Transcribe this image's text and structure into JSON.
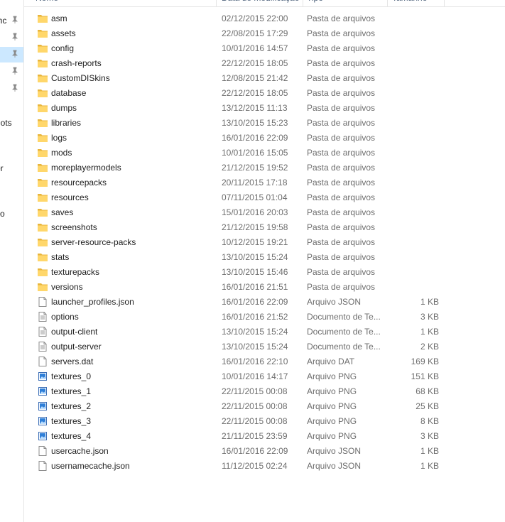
{
  "header": {
    "columns": [
      "Nome",
      "Data de modificação",
      "Tipo",
      "Tamanho"
    ]
  },
  "nav": {
    "items": [
      {
        "label": "lhc",
        "pinned": true,
        "selected": false
      },
      {
        "label": "",
        "pinned": true,
        "selected": false
      },
      {
        "label": "",
        "pinned": true,
        "selected": true
      },
      {
        "label": "",
        "pinned": true,
        "selected": false
      },
      {
        "label": "",
        "pinned": true,
        "selected": false
      },
      {
        "label": "hots",
        "pinned": false,
        "selected": false
      },
      {
        "label": "or",
        "pinned": false,
        "selected": false
      },
      {
        "label": "co",
        "pinned": false,
        "selected": false
      }
    ]
  },
  "files": [
    {
      "name": "asm",
      "date": "02/12/2015 22:00",
      "type": "Pasta de arquivos",
      "size": "",
      "icon": "folder-icon"
    },
    {
      "name": "assets",
      "date": "22/08/2015 17:29",
      "type": "Pasta de arquivos",
      "size": "",
      "icon": "folder-icon"
    },
    {
      "name": "config",
      "date": "10/01/2016 14:57",
      "type": "Pasta de arquivos",
      "size": "",
      "icon": "folder-icon"
    },
    {
      "name": "crash-reports",
      "date": "22/12/2015 18:05",
      "type": "Pasta de arquivos",
      "size": "",
      "icon": "folder-icon"
    },
    {
      "name": "CustomDISkins",
      "date": "12/08/2015 21:42",
      "type": "Pasta de arquivos",
      "size": "",
      "icon": "folder-icon"
    },
    {
      "name": "database",
      "date": "22/12/2015 18:05",
      "type": "Pasta de arquivos",
      "size": "",
      "icon": "folder-icon"
    },
    {
      "name": "dumps",
      "date": "13/12/2015 11:13",
      "type": "Pasta de arquivos",
      "size": "",
      "icon": "folder-icon"
    },
    {
      "name": "libraries",
      "date": "13/10/2015 15:23",
      "type": "Pasta de arquivos",
      "size": "",
      "icon": "folder-icon"
    },
    {
      "name": "logs",
      "date": "16/01/2016 22:09",
      "type": "Pasta de arquivos",
      "size": "",
      "icon": "folder-icon"
    },
    {
      "name": "mods",
      "date": "10/01/2016 15:05",
      "type": "Pasta de arquivos",
      "size": "",
      "icon": "folder-icon"
    },
    {
      "name": "moreplayermodels",
      "date": "21/12/2015 19:52",
      "type": "Pasta de arquivos",
      "size": "",
      "icon": "folder-icon"
    },
    {
      "name": "resourcepacks",
      "date": "20/11/2015 17:18",
      "type": "Pasta de arquivos",
      "size": "",
      "icon": "folder-icon"
    },
    {
      "name": "resources",
      "date": "07/11/2015 01:04",
      "type": "Pasta de arquivos",
      "size": "",
      "icon": "folder-icon"
    },
    {
      "name": "saves",
      "date": "15/01/2016 20:03",
      "type": "Pasta de arquivos",
      "size": "",
      "icon": "folder-icon"
    },
    {
      "name": "screenshots",
      "date": "21/12/2015 19:58",
      "type": "Pasta de arquivos",
      "size": "",
      "icon": "folder-icon"
    },
    {
      "name": "server-resource-packs",
      "date": "10/12/2015 19:21",
      "type": "Pasta de arquivos",
      "size": "",
      "icon": "folder-icon"
    },
    {
      "name": "stats",
      "date": "13/10/2015 15:24",
      "type": "Pasta de arquivos",
      "size": "",
      "icon": "folder-icon"
    },
    {
      "name": "texturepacks",
      "date": "13/10/2015 15:46",
      "type": "Pasta de arquivos",
      "size": "",
      "icon": "folder-icon"
    },
    {
      "name": "versions",
      "date": "16/01/2016 21:51",
      "type": "Pasta de arquivos",
      "size": "",
      "icon": "folder-icon"
    },
    {
      "name": "launcher_profiles.json",
      "date": "16/01/2016 22:09",
      "type": "Arquivo JSON",
      "size": "1 KB",
      "icon": "file-icon"
    },
    {
      "name": "options",
      "date": "16/01/2016 21:52",
      "type": "Documento de Te...",
      "size": "3 KB",
      "icon": "text-file-icon"
    },
    {
      "name": "output-client",
      "date": "13/10/2015 15:24",
      "type": "Documento de Te...",
      "size": "1 KB",
      "icon": "text-file-icon"
    },
    {
      "name": "output-server",
      "date": "13/10/2015 15:24",
      "type": "Documento de Te...",
      "size": "2 KB",
      "icon": "text-file-icon"
    },
    {
      "name": "servers.dat",
      "date": "16/01/2016 22:10",
      "type": "Arquivo DAT",
      "size": "169 KB",
      "icon": "file-icon"
    },
    {
      "name": "textures_0",
      "date": "10/01/2016 14:17",
      "type": "Arquivo PNG",
      "size": "151 KB",
      "icon": "image-file-icon"
    },
    {
      "name": "textures_1",
      "date": "22/11/2015 00:08",
      "type": "Arquivo PNG",
      "size": "68 KB",
      "icon": "image-file-icon"
    },
    {
      "name": "textures_2",
      "date": "22/11/2015 00:08",
      "type": "Arquivo PNG",
      "size": "25 KB",
      "icon": "image-file-icon"
    },
    {
      "name": "textures_3",
      "date": "22/11/2015 00:08",
      "type": "Arquivo PNG",
      "size": "8 KB",
      "icon": "image-file-icon"
    },
    {
      "name": "textures_4",
      "date": "21/11/2015 23:59",
      "type": "Arquivo PNG",
      "size": "3 KB",
      "icon": "image-file-icon"
    },
    {
      "name": "usercache.json",
      "date": "16/01/2016 22:09",
      "type": "Arquivo JSON",
      "size": "1 KB",
      "icon": "file-icon"
    },
    {
      "name": "usernamecache.json",
      "date": "11/12/2015 02:24",
      "type": "Arquivo JSON",
      "size": "1 KB",
      "icon": "file-icon"
    }
  ]
}
